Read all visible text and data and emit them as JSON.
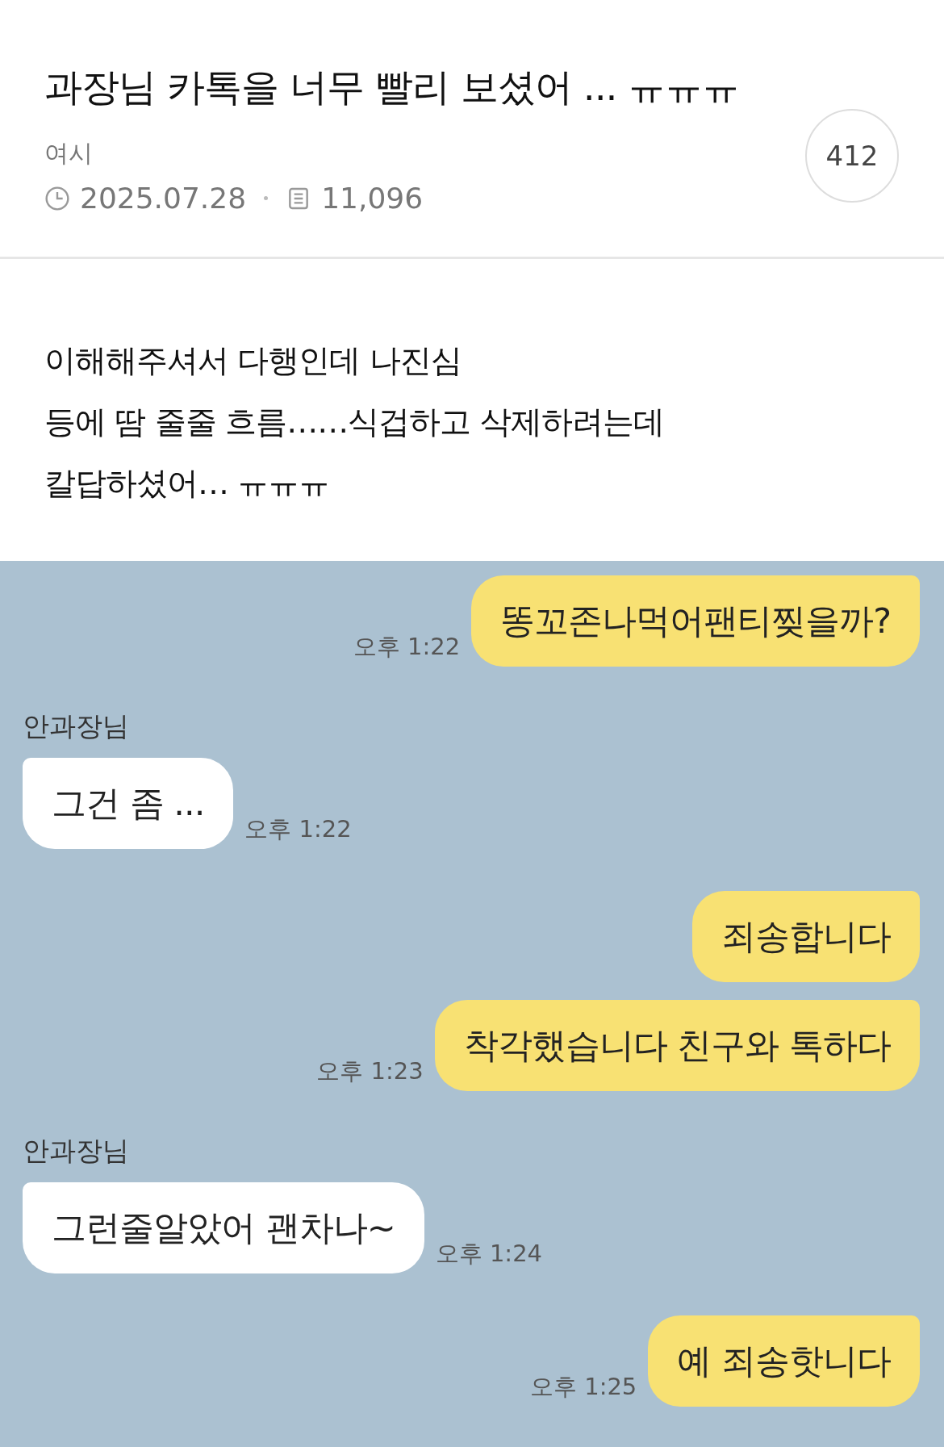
{
  "post": {
    "title": "과장님 카톡을 너무 빨리 보셨어 ... ㅠㅠㅠ",
    "author": "여시",
    "date": "2025.07.28",
    "views": "11,096",
    "comments": "412"
  },
  "body": [
    "이해해주셔서 다행인데 나진심",
    "등에 땀 줄줄 흐름……식겁하고 삭제하려는데",
    "칼답하셨어… ㅠㅠㅠ"
  ],
  "chat": [
    {
      "kind": "sent",
      "text": "똥꼬존나먹어팬티찢을까?",
      "time": "오후 1:22"
    },
    {
      "kind": "received",
      "sender": "안과장님",
      "text": "그건 좀 ...",
      "time": "오후 1:22"
    },
    {
      "kind": "sent",
      "text": "죄송합니다"
    },
    {
      "kind": "sent",
      "text": "착각했습니다 친구와 톡하다",
      "time": "오후 1:23"
    },
    {
      "kind": "received",
      "sender": "안과장님",
      "text": "그런줄알았어 괜차나~",
      "time": "오후 1:24"
    },
    {
      "kind": "sent",
      "text": "예 죄송핫니다",
      "time": "오후 1:25"
    }
  ]
}
